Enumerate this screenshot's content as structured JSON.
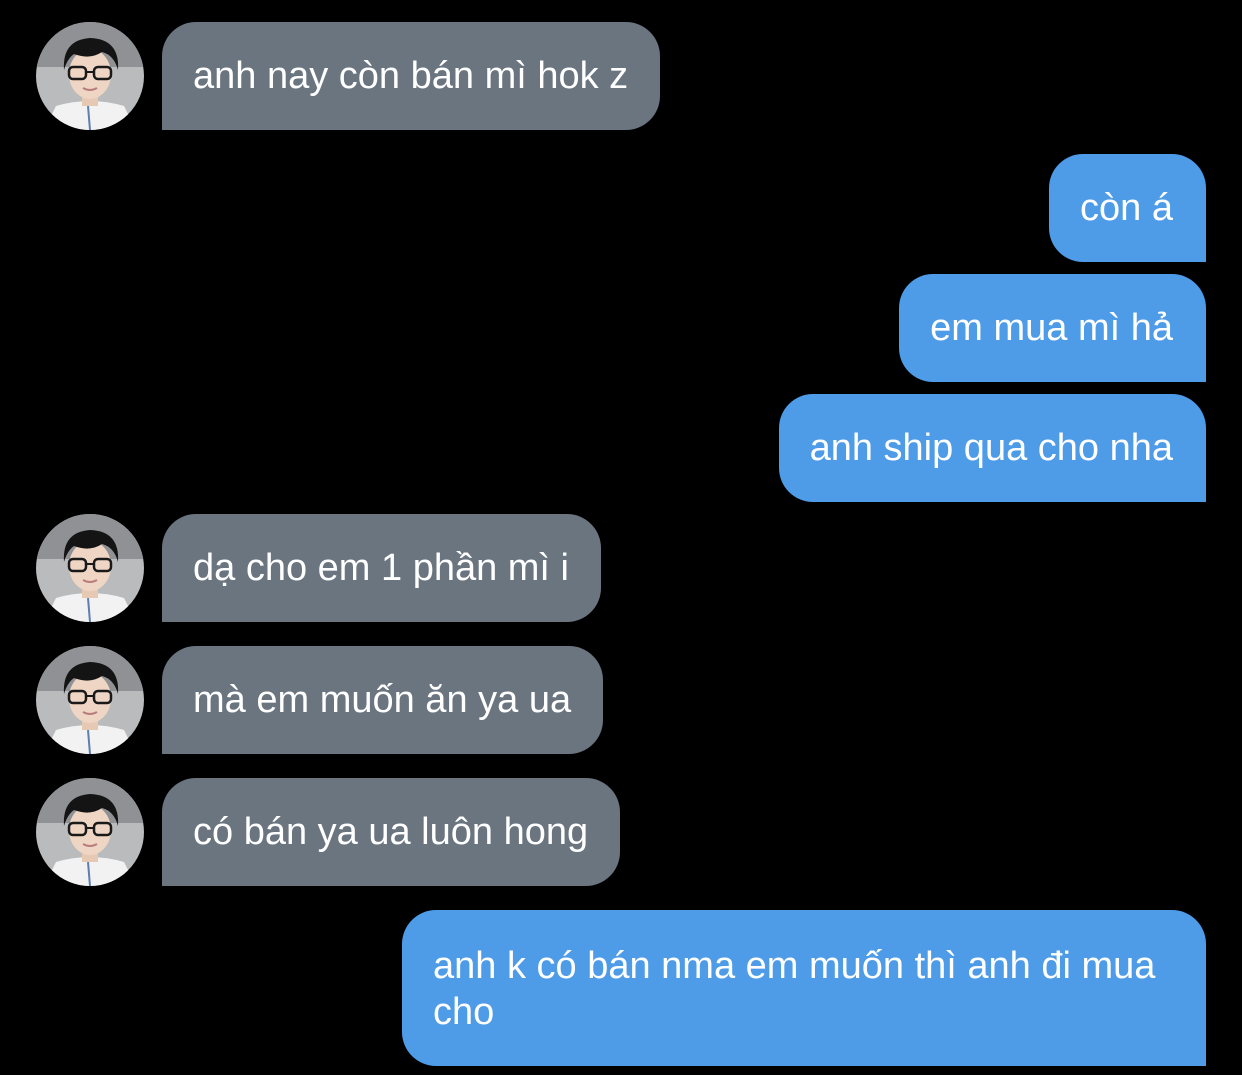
{
  "colors": {
    "background": "#000000",
    "incoming_bubble": "#6a7580",
    "outgoing_bubble": "#4e9be8",
    "text": "#ffffff"
  },
  "contact": {
    "avatar_icon": "profile-photo-young-man-with-glasses-icon"
  },
  "messages": [
    {
      "direction": "incoming",
      "text": "anh nay còn bán mì hok z"
    },
    {
      "direction": "outgoing",
      "text": "còn á"
    },
    {
      "direction": "outgoing",
      "text": "em mua mì hả"
    },
    {
      "direction": "outgoing",
      "text": "anh ship qua cho nha"
    },
    {
      "direction": "incoming",
      "text": "dạ cho em 1 phần mì i"
    },
    {
      "direction": "incoming",
      "text": "mà em muốn ăn ya ua"
    },
    {
      "direction": "incoming",
      "text": "có bán ya ua luôn hong"
    },
    {
      "direction": "outgoing",
      "text": "anh k có bán nma em muốn thì anh đi mua cho"
    }
  ]
}
